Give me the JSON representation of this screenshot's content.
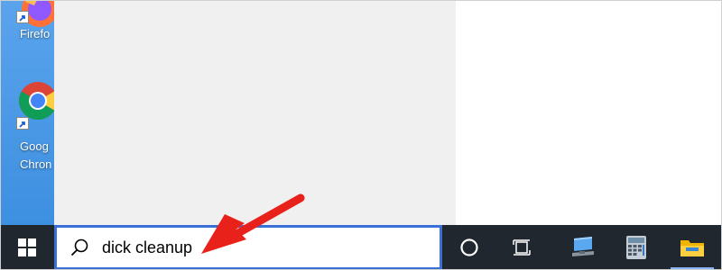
{
  "desktop": {
    "icons": [
      {
        "name": "firefox",
        "label": "Firefo"
      },
      {
        "name": "google-chrome",
        "label_line1": "Goog",
        "label_line2": "Chron"
      }
    ]
  },
  "taskbar": {
    "search": {
      "value": "dick cleanup",
      "placeholder": ""
    },
    "buttons": [
      {
        "icon": "cortana-icon"
      },
      {
        "icon": "task-view-icon"
      },
      {
        "icon": "computer-icon"
      },
      {
        "icon": "calculator-icon"
      },
      {
        "icon": "file-explorer-icon"
      }
    ]
  },
  "colors": {
    "taskbar_bg": "#20272e",
    "search_border": "#3a6fd8",
    "desktop_bg": "#4a97e6",
    "start_panel_bg": "#f0f0f0",
    "annotation_arrow": "#e8221b"
  }
}
